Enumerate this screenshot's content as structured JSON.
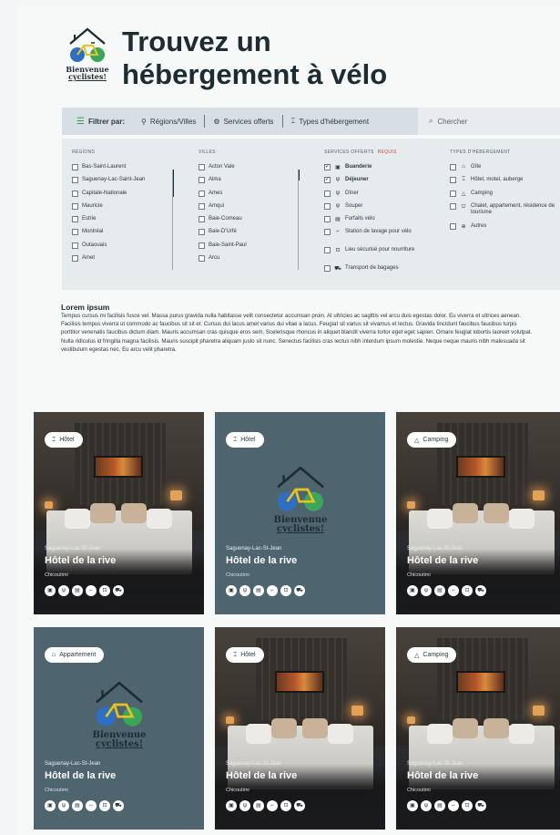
{
  "logo": {
    "text_line1": "Bienvenue",
    "text_line2": "cyclistes!"
  },
  "page_title_line1": "Trouvez un",
  "page_title_line2": "hébergement à vélo",
  "filterbar": {
    "filter_label": "Filtrer par:",
    "regions": "Régions/Villes",
    "services": "Services offerts",
    "types": "Types d'hébergement",
    "search_placeholder": "Chercher"
  },
  "filters": {
    "regions": {
      "heading": "Régions",
      "items": [
        "Bas-Saint-Laurent",
        "Saguenay-Lac-Saint-Jean",
        "Capitale-Nationale",
        "Mauricie",
        "Estrie",
        "Montréal",
        "Outaouais",
        "Amet"
      ]
    },
    "villes": {
      "heading": "Villes",
      "items": [
        "Acton Vale",
        "Alma",
        "Ames",
        "Amqui",
        "Baie-Comeau",
        "Baie-D'Urfé",
        "Baie-Saint-Paul",
        "Arcu"
      ]
    },
    "services": {
      "heading": "Services offerts",
      "required": "Requis",
      "items": [
        {
          "label": "Buanderie",
          "checked": true,
          "icon": "laundry-icon"
        },
        {
          "label": "Déjeuner",
          "checked": true,
          "icon": "fork-knife-icon"
        },
        {
          "label": "Dîner",
          "checked": false,
          "icon": "fork-knife-icon"
        },
        {
          "label": "Souper",
          "checked": false,
          "icon": "fork-knife-icon"
        },
        {
          "label": "Forfaits vélo",
          "checked": false,
          "icon": "ticket-icon"
        },
        {
          "label": "Station de lavage pour vélo",
          "checked": false,
          "icon": "hose-icon"
        },
        {
          "label": "Lieu sécurisé pour nourriture",
          "checked": false,
          "icon": "lock-icon"
        },
        {
          "label": "Transport de bagages",
          "checked": false,
          "icon": "truck-icon"
        }
      ]
    },
    "types": {
      "heading": "Types d'hébergement",
      "items": [
        {
          "label": "Gîte",
          "icon": "house-icon"
        },
        {
          "label": "Hôtel, motel, auberge",
          "icon": "bed-icon"
        },
        {
          "label": "Camping",
          "icon": "tent-icon"
        },
        {
          "label": "Chalet, appartement, résidence de tourisme",
          "icon": "cabin-icon"
        },
        {
          "label": "Autres",
          "icon": "other-icon"
        }
      ]
    }
  },
  "intro": {
    "heading": "Lorem ipsum",
    "body": "Tempus cursus mi facilisis fusce vel. Massa purus gravida nulla habitasse velit consectetur accumsan proin. At ultricies ac sagittis vel arcu duis egestas dolor. Eu viverra et ultrices aenean. Facilisis tempus viverra ut commodo ac faucibus sit sit et. Cursus dui lacus amet varius dui vitae a lacus. Feugiat sit varius sit vivamus et lectus. Gravida tincidunt faucibus faucibus turpis porttitor venenatis faucibus dictum diam. Mauris accumsan cras quisque eros sem. Scelerisque rhoncus in aliquet blandit viverra tortor eget eget sapien. Ornare feugiat lobortis laoreet volutpat. Nulla ridiculus id fringilla magna facilisis. Mauris suscipit pharetra aliquam justo sit nunc. Senectus facilisis cras lectus nibh interdum ipsum molestie. Neque neque mauris nibh malesuada sit vestibulum egestas nec. Eu arcu velit pharetra."
  },
  "cards": [
    {
      "tag": "Hôtel",
      "tag_icon": "bed-icon",
      "style": "photo",
      "region": "Saguenay-Lac-St-Jean",
      "name": "Hôtel de la rive",
      "city": "Chicoutimi"
    },
    {
      "tag": "Hôtel",
      "tag_icon": "bed-icon",
      "style": "slate",
      "region": "Saguenay-Lac-St-Jean",
      "name": "Hôtel de la rive",
      "city": "Chicoutimi"
    },
    {
      "tag": "Camping",
      "tag_icon": "tent-icon",
      "style": "photo",
      "region": "Saguenay-Lac-St-Jean",
      "name": "Hôtel de la rive",
      "city": "Chicoutimi"
    },
    {
      "tag": "Appartement",
      "tag_icon": "house-icon",
      "style": "slate",
      "region": "Saguenay-Lac-St-Jean",
      "name": "Hôtel de la rive",
      "city": "Chicoutimi"
    },
    {
      "tag": "Hôtel",
      "tag_icon": "bed-icon",
      "style": "photo",
      "region": "Saguenay-Lac-St-Jean",
      "name": "Hôtel de la rive",
      "city": "Chicoutimi"
    },
    {
      "tag": "Camping",
      "tag_icon": "tent-icon",
      "style": "photo",
      "region": "Saguenay-Lac-St-Jean",
      "name": "Hôtel de la rive",
      "city": "Chicoutimi"
    }
  ],
  "card_service_icons": [
    "laundry-icon",
    "fork-knife-icon",
    "ticket-icon",
    "hose-icon",
    "lock-icon",
    "truck-icon"
  ],
  "colors": {
    "slate_card": "#4e6570",
    "filterbar": "#d7dfe4",
    "panel": "#e6ebee",
    "required": "#d64545",
    "bike_blue": "#2e6fc4",
    "bike_green": "#3aa65a",
    "bike_yellow": "#e8c21f"
  }
}
